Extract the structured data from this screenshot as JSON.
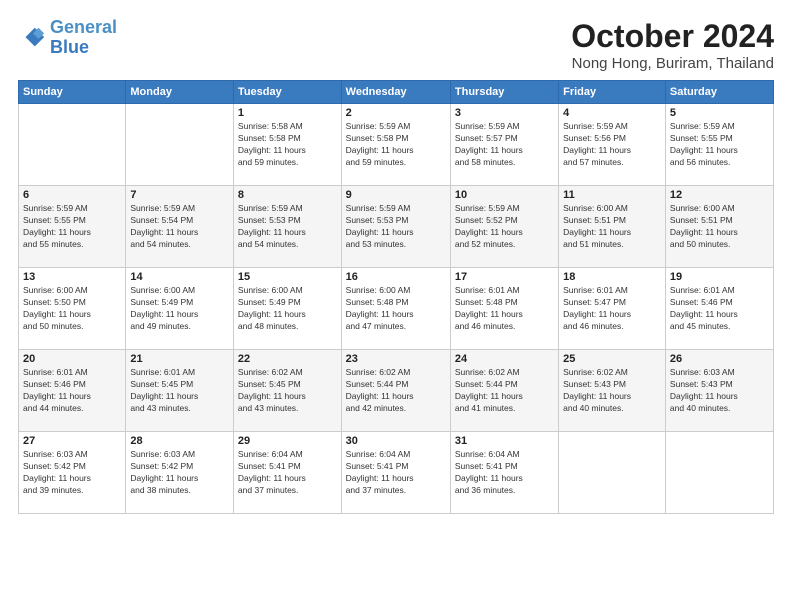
{
  "header": {
    "logo_line1": "General",
    "logo_line2": "Blue",
    "month": "October 2024",
    "location": "Nong Hong, Buriram, Thailand"
  },
  "days_of_week": [
    "Sunday",
    "Monday",
    "Tuesday",
    "Wednesday",
    "Thursday",
    "Friday",
    "Saturday"
  ],
  "weeks": [
    [
      {
        "num": "",
        "info": ""
      },
      {
        "num": "",
        "info": ""
      },
      {
        "num": "1",
        "info": "Sunrise: 5:58 AM\nSunset: 5:58 PM\nDaylight: 11 hours\nand 59 minutes."
      },
      {
        "num": "2",
        "info": "Sunrise: 5:59 AM\nSunset: 5:58 PM\nDaylight: 11 hours\nand 59 minutes."
      },
      {
        "num": "3",
        "info": "Sunrise: 5:59 AM\nSunset: 5:57 PM\nDaylight: 11 hours\nand 58 minutes."
      },
      {
        "num": "4",
        "info": "Sunrise: 5:59 AM\nSunset: 5:56 PM\nDaylight: 11 hours\nand 57 minutes."
      },
      {
        "num": "5",
        "info": "Sunrise: 5:59 AM\nSunset: 5:55 PM\nDaylight: 11 hours\nand 56 minutes."
      }
    ],
    [
      {
        "num": "6",
        "info": "Sunrise: 5:59 AM\nSunset: 5:55 PM\nDaylight: 11 hours\nand 55 minutes."
      },
      {
        "num": "7",
        "info": "Sunrise: 5:59 AM\nSunset: 5:54 PM\nDaylight: 11 hours\nand 54 minutes."
      },
      {
        "num": "8",
        "info": "Sunrise: 5:59 AM\nSunset: 5:53 PM\nDaylight: 11 hours\nand 54 minutes."
      },
      {
        "num": "9",
        "info": "Sunrise: 5:59 AM\nSunset: 5:53 PM\nDaylight: 11 hours\nand 53 minutes."
      },
      {
        "num": "10",
        "info": "Sunrise: 5:59 AM\nSunset: 5:52 PM\nDaylight: 11 hours\nand 52 minutes."
      },
      {
        "num": "11",
        "info": "Sunrise: 6:00 AM\nSunset: 5:51 PM\nDaylight: 11 hours\nand 51 minutes."
      },
      {
        "num": "12",
        "info": "Sunrise: 6:00 AM\nSunset: 5:51 PM\nDaylight: 11 hours\nand 50 minutes."
      }
    ],
    [
      {
        "num": "13",
        "info": "Sunrise: 6:00 AM\nSunset: 5:50 PM\nDaylight: 11 hours\nand 50 minutes."
      },
      {
        "num": "14",
        "info": "Sunrise: 6:00 AM\nSunset: 5:49 PM\nDaylight: 11 hours\nand 49 minutes."
      },
      {
        "num": "15",
        "info": "Sunrise: 6:00 AM\nSunset: 5:49 PM\nDaylight: 11 hours\nand 48 minutes."
      },
      {
        "num": "16",
        "info": "Sunrise: 6:00 AM\nSunset: 5:48 PM\nDaylight: 11 hours\nand 47 minutes."
      },
      {
        "num": "17",
        "info": "Sunrise: 6:01 AM\nSunset: 5:48 PM\nDaylight: 11 hours\nand 46 minutes."
      },
      {
        "num": "18",
        "info": "Sunrise: 6:01 AM\nSunset: 5:47 PM\nDaylight: 11 hours\nand 46 minutes."
      },
      {
        "num": "19",
        "info": "Sunrise: 6:01 AM\nSunset: 5:46 PM\nDaylight: 11 hours\nand 45 minutes."
      }
    ],
    [
      {
        "num": "20",
        "info": "Sunrise: 6:01 AM\nSunset: 5:46 PM\nDaylight: 11 hours\nand 44 minutes."
      },
      {
        "num": "21",
        "info": "Sunrise: 6:01 AM\nSunset: 5:45 PM\nDaylight: 11 hours\nand 43 minutes."
      },
      {
        "num": "22",
        "info": "Sunrise: 6:02 AM\nSunset: 5:45 PM\nDaylight: 11 hours\nand 43 minutes."
      },
      {
        "num": "23",
        "info": "Sunrise: 6:02 AM\nSunset: 5:44 PM\nDaylight: 11 hours\nand 42 minutes."
      },
      {
        "num": "24",
        "info": "Sunrise: 6:02 AM\nSunset: 5:44 PM\nDaylight: 11 hours\nand 41 minutes."
      },
      {
        "num": "25",
        "info": "Sunrise: 6:02 AM\nSunset: 5:43 PM\nDaylight: 11 hours\nand 40 minutes."
      },
      {
        "num": "26",
        "info": "Sunrise: 6:03 AM\nSunset: 5:43 PM\nDaylight: 11 hours\nand 40 minutes."
      }
    ],
    [
      {
        "num": "27",
        "info": "Sunrise: 6:03 AM\nSunset: 5:42 PM\nDaylight: 11 hours\nand 39 minutes."
      },
      {
        "num": "28",
        "info": "Sunrise: 6:03 AM\nSunset: 5:42 PM\nDaylight: 11 hours\nand 38 minutes."
      },
      {
        "num": "29",
        "info": "Sunrise: 6:04 AM\nSunset: 5:41 PM\nDaylight: 11 hours\nand 37 minutes."
      },
      {
        "num": "30",
        "info": "Sunrise: 6:04 AM\nSunset: 5:41 PM\nDaylight: 11 hours\nand 37 minutes."
      },
      {
        "num": "31",
        "info": "Sunrise: 6:04 AM\nSunset: 5:41 PM\nDaylight: 11 hours\nand 36 minutes."
      },
      {
        "num": "",
        "info": ""
      },
      {
        "num": "",
        "info": ""
      }
    ]
  ]
}
